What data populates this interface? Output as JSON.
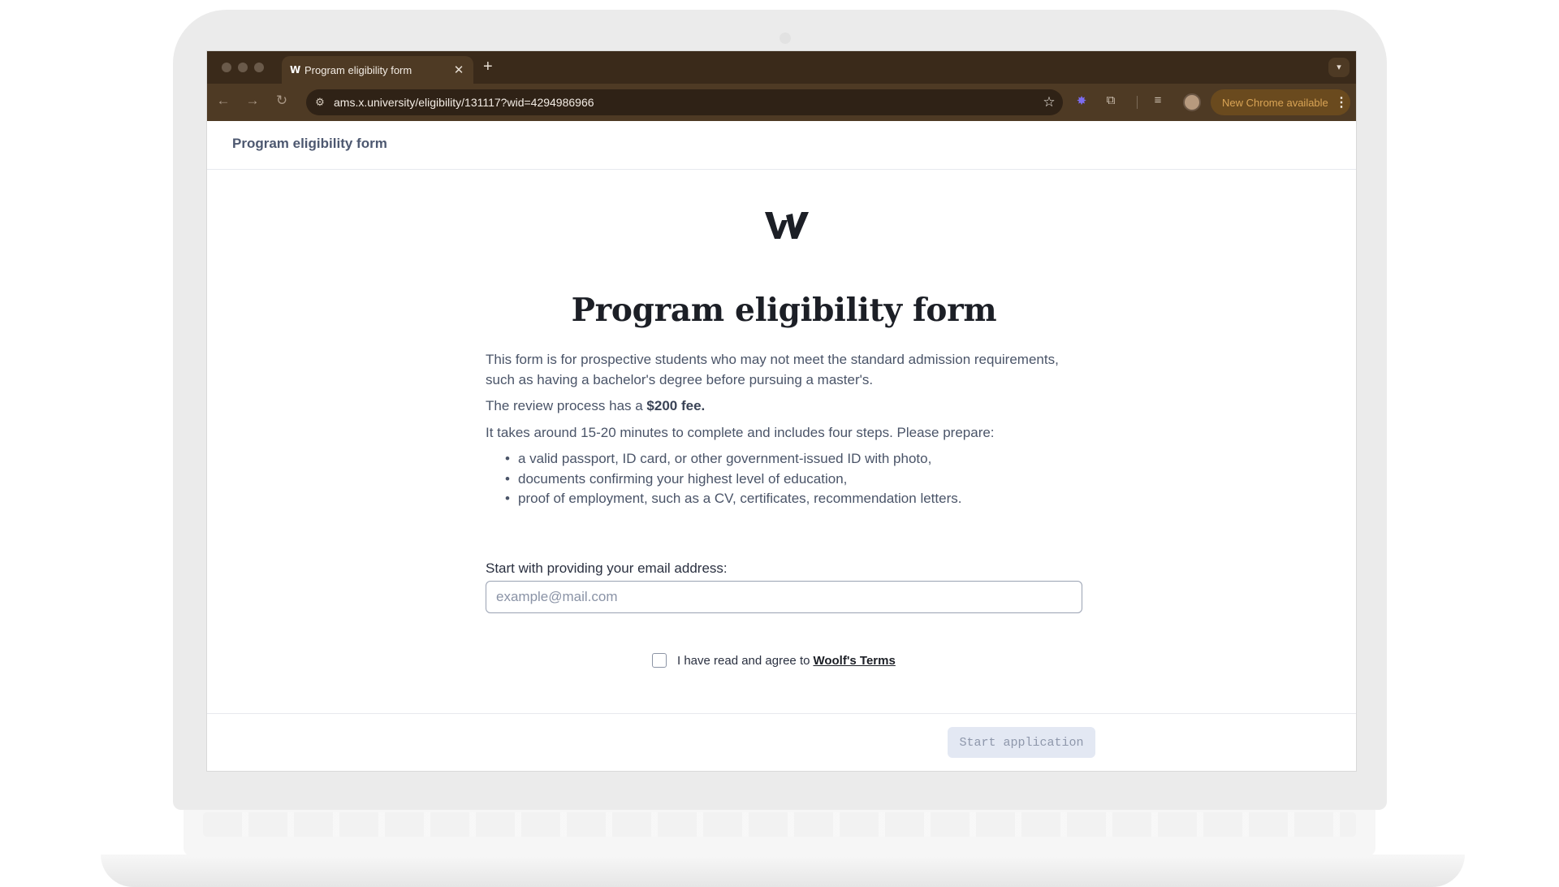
{
  "browser": {
    "tab_title": "Program eligibility form",
    "tab_favicon": "W",
    "url": "ams.x.university/eligibility/131117?wid=4294986966",
    "update_label": "New Chrome available",
    "icons": {
      "back": "arrow-left",
      "forward": "arrow-right",
      "reload": "reload",
      "site_settings": "tune",
      "bookmark": "star",
      "extension_purple": "gear",
      "extensions": "puzzle",
      "reading_list": "list",
      "profile": "avatar",
      "menu": "kebab"
    }
  },
  "app": {
    "header_title": "Program eligibility form"
  },
  "form": {
    "title": "Program eligibility form",
    "intro": "This form is for prospective students who may not meet the standard admission requirements, such as having a bachelor's degree before pursuing a master's.",
    "fee_prefix": "The review process has a ",
    "fee_amount": "$200 fee.",
    "steps_text": "It takes around 15-20 minutes to complete and includes four steps. Please prepare:",
    "requirements": [
      "a valid passport, ID card, or other government-issued ID with photo,",
      "documents confirming your highest level of education,",
      "proof of employment, such as a CV, certificates, recommendation letters."
    ],
    "email_label": "Start with providing your email address:",
    "email_placeholder": "example@mail.com",
    "email_value": "",
    "terms_text": "I have read and agree to",
    "terms_link": "Woolf's Terms",
    "terms_checked": false,
    "start_button": "Start application"
  },
  "colors": {
    "browser_frame": "#3a2a1a",
    "toolbar": "#4e3a24",
    "update_accent": "#d9a455",
    "button_disabled_bg": "#e3e8f3",
    "button_disabled_text": "#8e97ab"
  }
}
